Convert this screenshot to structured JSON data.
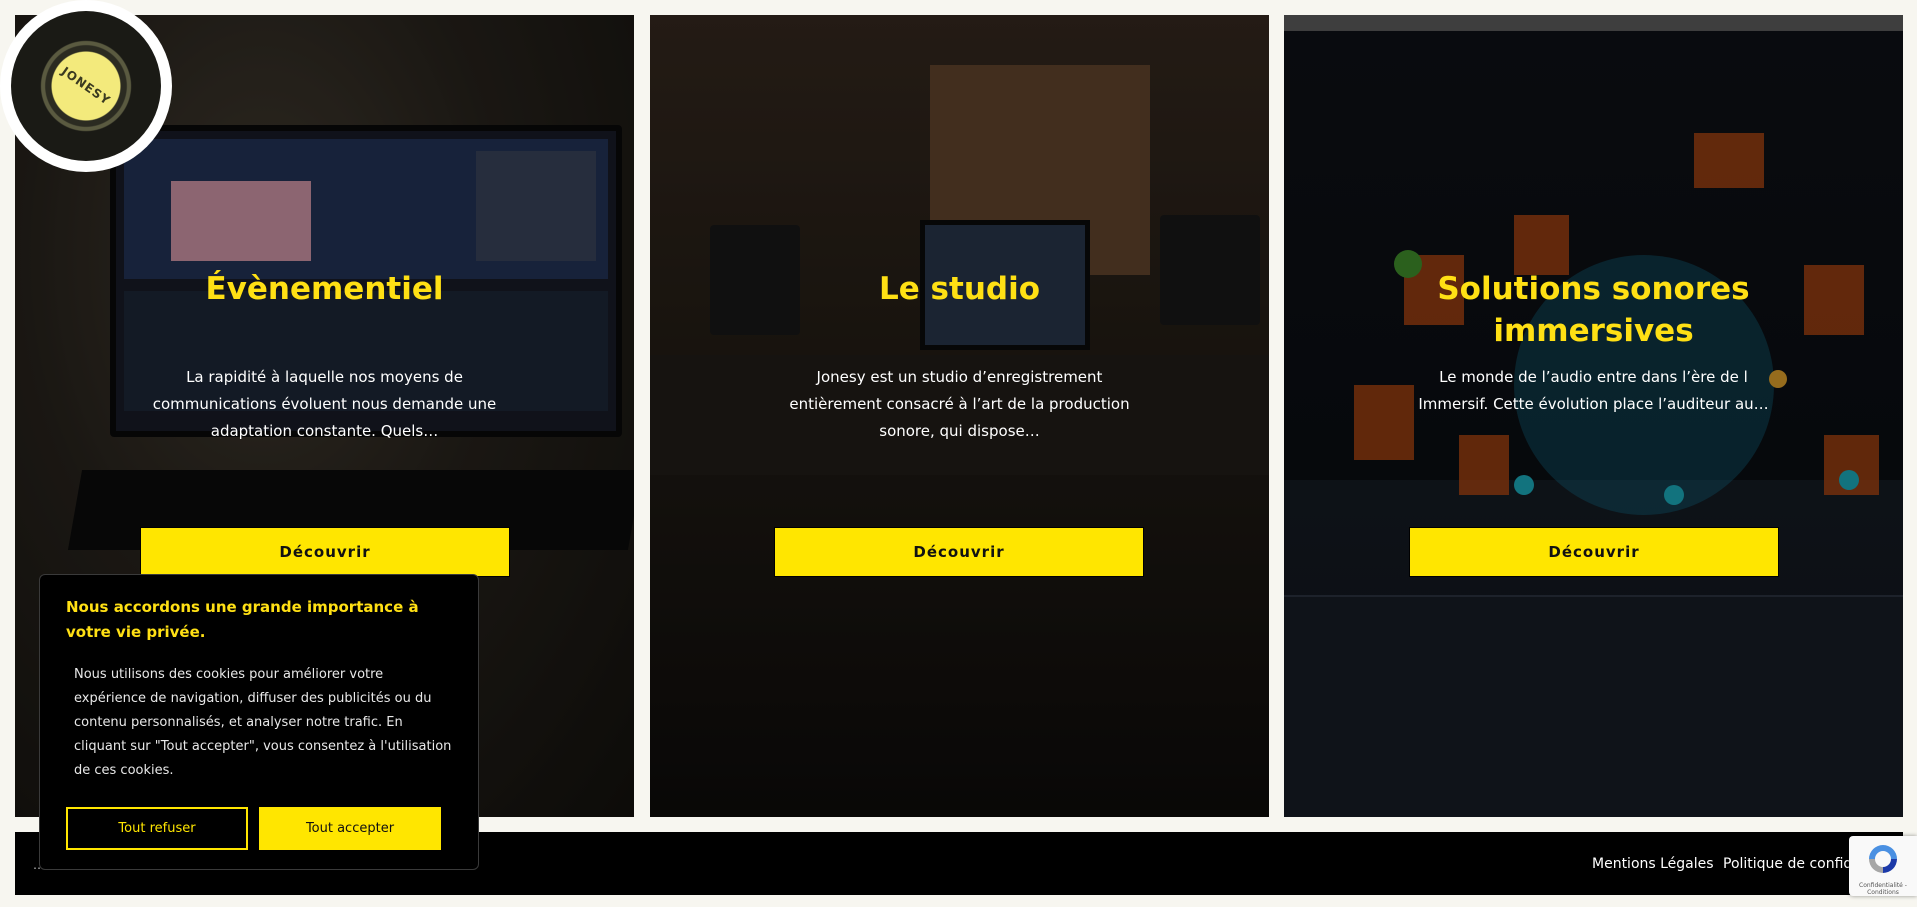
{
  "logo": {
    "text": "JONESY"
  },
  "panels": [
    {
      "title": "Évènementiel",
      "text": "La rapidité à laquelle nos moyens de communications évoluent nous demande une adaptation constante. Quels…",
      "button": "Découvrir"
    },
    {
      "title": "Le studio",
      "text": "Jonesy est un studio d’enregistrement entièrement consacré à l’art de la production sonore, qui dispose…",
      "button": "Découvrir"
    },
    {
      "title_line1": "Solutions sonores",
      "title_line2": "immersives",
      "text": "Le monde de l’audio entre dans l’ère de l Immersif. Cette évolution place l’auditeur au…",
      "button": "Découvrir"
    }
  ],
  "cookie": {
    "title": "Nous accordons une grande importance à votre vie privée.",
    "text": "Nous utilisons des cookies pour améliorer votre expérience de navigation, diffuser des publicités ou du contenu personnalisés, et analyser notre trafic. En cliquant sur \"Tout accepter\", vous consentez à l'utilisation de ces cookies.",
    "refuse": "Tout refuser",
    "accept": "Tout accepter"
  },
  "footer": {
    "mentions": "Mentions Légales",
    "policy": "Politique de confidentialité"
  },
  "recaptcha": {
    "label": "Confidentialité - Conditions"
  },
  "colors": {
    "accent": "#ffe600",
    "background": "#f7f6f0",
    "footer": "#000000"
  }
}
